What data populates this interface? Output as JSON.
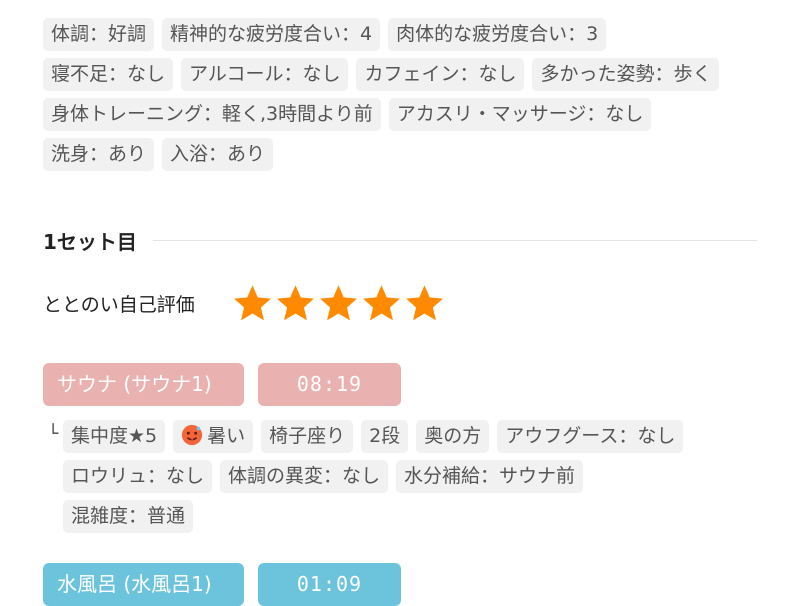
{
  "condition_tags": [
    [
      "体調：好調",
      "精神的な疲労度合い：4",
      "肉体的な疲労度合い：3"
    ],
    [
      "寝不足：なし",
      "アルコール：なし",
      "カフェイン：なし",
      "多かった姿勢：歩く"
    ],
    [
      "身体トレーニング：軽く,3時間より前",
      "アカスリ・マッサージ：なし"
    ],
    [
      "洗身：あり",
      "入浴：あり"
    ]
  ],
  "set": {
    "title": "1セット目",
    "rating_label": "ととのい自己評価",
    "rating_stars": 5,
    "star_color": "#ff8a00"
  },
  "sauna": {
    "name": "サウナ (サウナ1)",
    "time": "08:19",
    "color": "#eab1b1",
    "detail_mark": "└",
    "detail_rows": [
      [
        "集中度★5",
        "暑い",
        "椅子座り",
        "2段",
        "奥の方",
        "アウフグース：なし"
      ],
      [
        "ロウリュ：なし",
        "体調の異変：なし",
        "水分補給：サウナ前"
      ],
      [
        "混雑度：普通"
      ]
    ],
    "hot_icon": "hot-face-icon"
  },
  "water": {
    "name": "水風呂 (水風呂1)",
    "time": "01:09",
    "color": "#6cc3dc"
  }
}
